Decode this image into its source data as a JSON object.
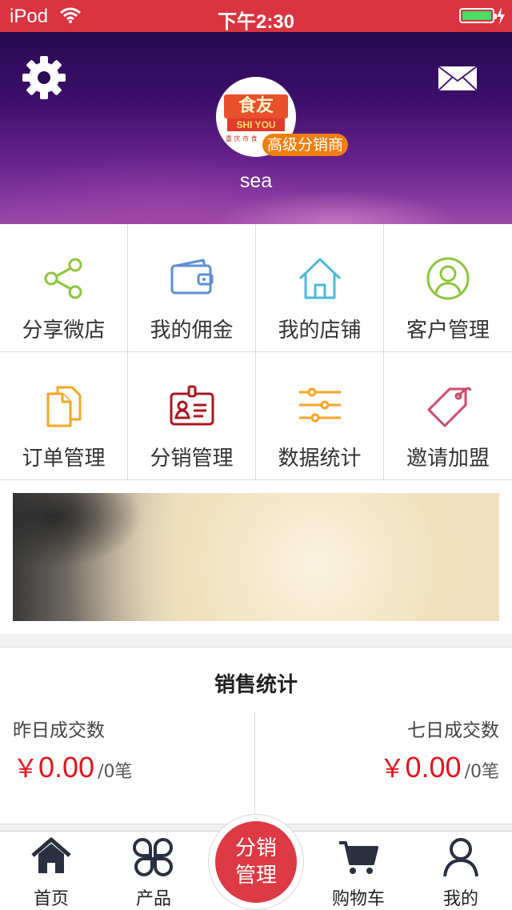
{
  "status_bar": {
    "carrier": "iPod",
    "time": "下午2:30"
  },
  "header": {
    "logo_text_top": "食友",
    "logo_text_mid": "SHI YOU",
    "logo_text_bottom": "重 庆 市 食",
    "level_badge": "高级分销商",
    "username": "sea"
  },
  "menu": {
    "items": [
      {
        "label": "分享微店",
        "icon": "share-icon",
        "color": "#8cc63f"
      },
      {
        "label": "我的佣金",
        "icon": "wallet-icon",
        "color": "#5b8fd6"
      },
      {
        "label": "我的店铺",
        "icon": "home-icon",
        "color": "#4fb8d8"
      },
      {
        "label": "客户管理",
        "icon": "user-circle-icon",
        "color": "#8cc63f"
      },
      {
        "label": "订单管理",
        "icon": "documents-icon",
        "color": "#f5a623"
      },
      {
        "label": "分销管理",
        "icon": "id-badge-icon",
        "color": "#a8171f"
      },
      {
        "label": "数据统计",
        "icon": "sliders-icon",
        "color": "#f5a623"
      },
      {
        "label": "邀请加盟",
        "icon": "tag-icon",
        "color": "#c94d6c"
      }
    ]
  },
  "stats": {
    "title": "销售统计",
    "yesterday": {
      "label": "昨日成交数",
      "currency": "￥",
      "amount": "0.00",
      "count": "/0笔"
    },
    "seven_days": {
      "label": "七日成交数",
      "currency": "￥",
      "amount": "0.00",
      "count": "/0笔"
    }
  },
  "tabbar": {
    "home": "首页",
    "products": "产品",
    "center_line1": "分销",
    "center_line2": "管理",
    "cart": "购物车",
    "mine": "我的"
  }
}
